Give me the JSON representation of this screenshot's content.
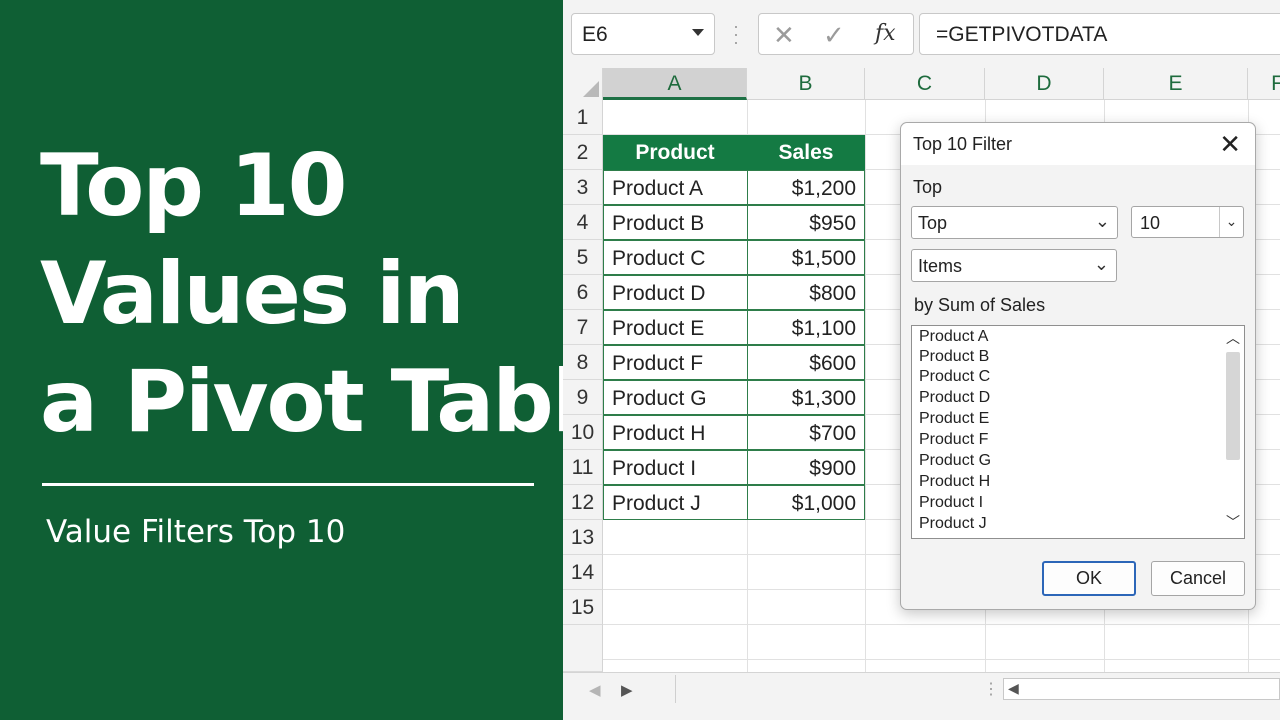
{
  "banner": {
    "title_lines": [
      "Top 10",
      "Values in",
      "a Pivot Table"
    ],
    "subtitle": "Value Filters Top 10",
    "background_color": "#0f5f34"
  },
  "formula_bar": {
    "name_box": "E6",
    "cancel_glyph": "✕",
    "enter_glyph": "✓",
    "fx_label": "fx",
    "formula": "=GETPIVOTDATA"
  },
  "sheet": {
    "columns": [
      "A",
      "B",
      "C",
      "D",
      "E",
      "F"
    ],
    "rows": [
      "1",
      "2",
      "3",
      "4",
      "5",
      "6",
      "7",
      "8",
      "9",
      "10",
      "11",
      "12",
      "13",
      "14",
      "15"
    ],
    "table": {
      "headers": [
        "Product",
        "Sales"
      ],
      "rows": [
        [
          "Product A",
          "$1,200"
        ],
        [
          "Product B",
          "$950"
        ],
        [
          "Product C",
          "$1,500"
        ],
        [
          "Product D",
          "$800"
        ],
        [
          "Product E",
          "$1,100"
        ],
        [
          "Product F",
          "$600"
        ],
        [
          "Product G",
          "$1,300"
        ],
        [
          "Product H",
          "$700"
        ],
        [
          "Product I",
          "$900"
        ],
        [
          "Product J",
          "$1,000"
        ]
      ],
      "header_color": "#147a43",
      "border_color": "#2e7d4a"
    }
  },
  "dialog": {
    "title": "Top 10 Filter",
    "close_glyph": "✕",
    "section_label": "Top",
    "direction": "Top",
    "count": "10",
    "unit": "Items",
    "by_label": "by Sum of Sales",
    "list_items": [
      "Product A",
      "Product B",
      "Product C",
      "Product D",
      "Product E",
      "Product F",
      "Product G",
      "Product H",
      "Product I",
      "Product J"
    ],
    "ok_label": "OK",
    "cancel_label": "Cancel",
    "accent_color": "#2c66b8"
  }
}
